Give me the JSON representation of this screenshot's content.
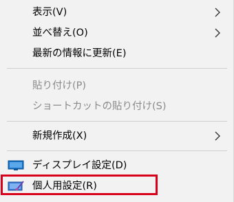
{
  "menu": {
    "items": [
      {
        "label": "表示(V)"
      },
      {
        "label": "並べ替え(O)"
      },
      {
        "label": "最新の情報に更新(E)"
      },
      {
        "label": "貼り付け(P)"
      },
      {
        "label": "ショートカットの貼り付け(S)"
      },
      {
        "label": "新規作成(X)"
      },
      {
        "label": "ディスプレイ設定(D)"
      },
      {
        "label": "個人用設定(R)"
      }
    ]
  },
  "colors": {
    "menu_background": "#f2f2f2",
    "disabled_text": "#8a8a8a",
    "highlight_border": "#d9001b",
    "display_icon": "#1a73c8",
    "personalize_icon": "#3a7bd5"
  },
  "icons": {
    "submenu": "chevron-right-icon",
    "display_settings": "monitor-icon",
    "personalize": "monitor-brush-icon"
  }
}
